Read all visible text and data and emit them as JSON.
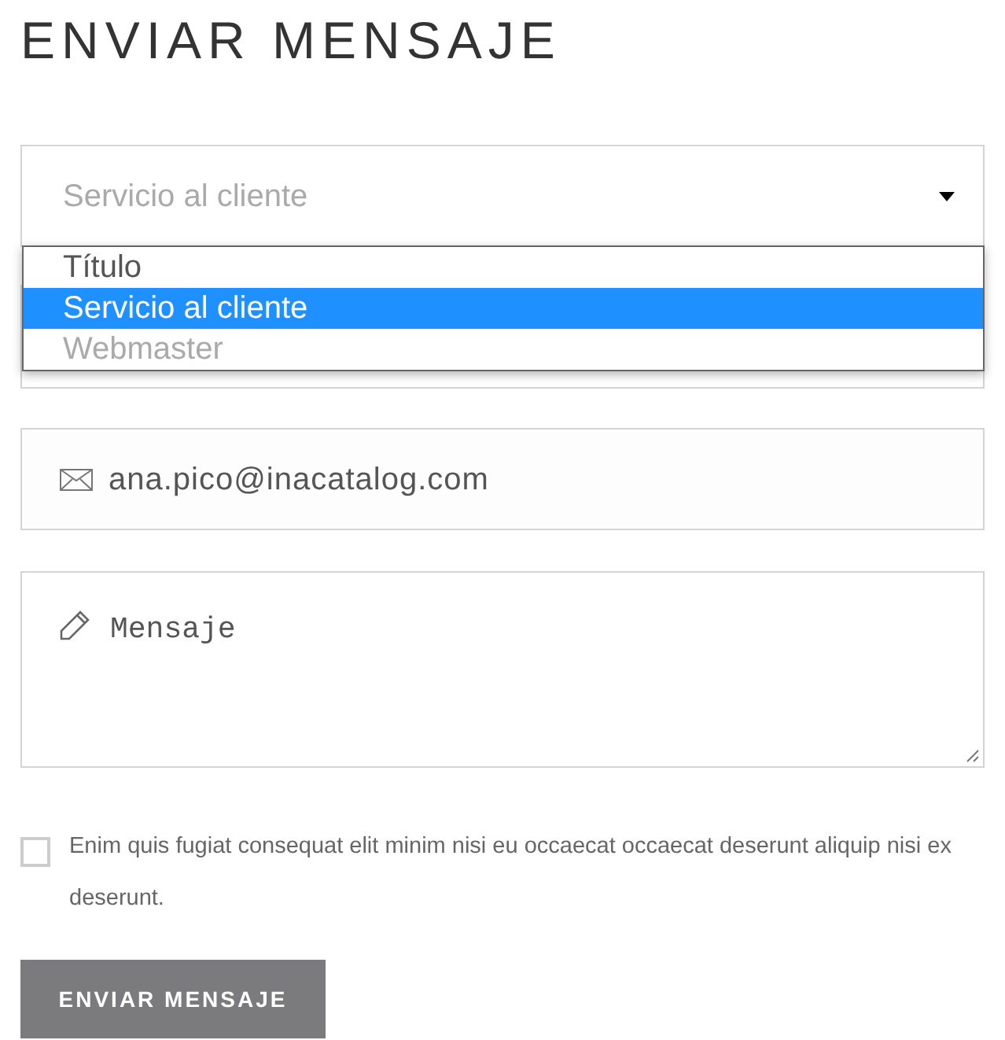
{
  "heading": "ENVIAR MENSAJE",
  "select": {
    "value": "Servicio al cliente",
    "expanded": true,
    "options": [
      {
        "label": "Título",
        "selected": false,
        "disabled": false
      },
      {
        "label": "Servicio al cliente",
        "selected": true,
        "disabled": false
      },
      {
        "label": "Webmaster",
        "selected": false,
        "disabled": true
      }
    ]
  },
  "email": {
    "value": "ana.pico@inacatalog.com"
  },
  "message": {
    "placeholder": "Mensaje"
  },
  "consent": {
    "checked": false,
    "text": "Enim quis fugiat consequat elit minim nisi eu occaecat occaecat deserunt aliquip nisi ex deserunt."
  },
  "submit": "ENVIAR MENSAJE"
}
